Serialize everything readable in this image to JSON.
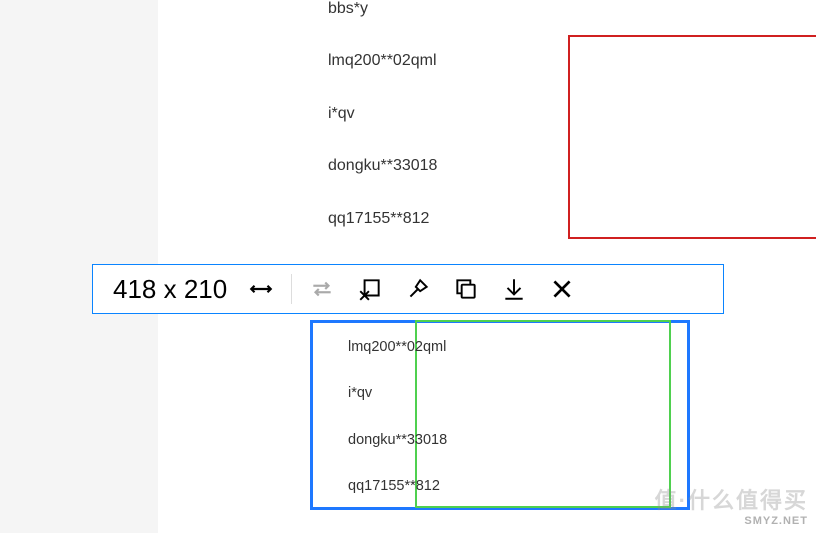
{
  "toolbar": {
    "dimensions": "418 x 210"
  },
  "selections": {
    "red": {
      "color": "#d02020"
    },
    "blue": {
      "color": "#1e78ff"
    },
    "green": {
      "color": "#4fd04f"
    }
  },
  "users_top": [
    "bbs*y",
    "lmq200**02qml",
    "i*qv",
    "dongku**33018",
    "qq17155**812"
  ],
  "users_bottom": [
    "lmq200**02qml",
    "i*qv",
    "dongku**33018",
    "qq17155**812"
  ],
  "watermark": {
    "text_cn": "值·什么值得买",
    "text_en": "SMYZ.NET"
  }
}
